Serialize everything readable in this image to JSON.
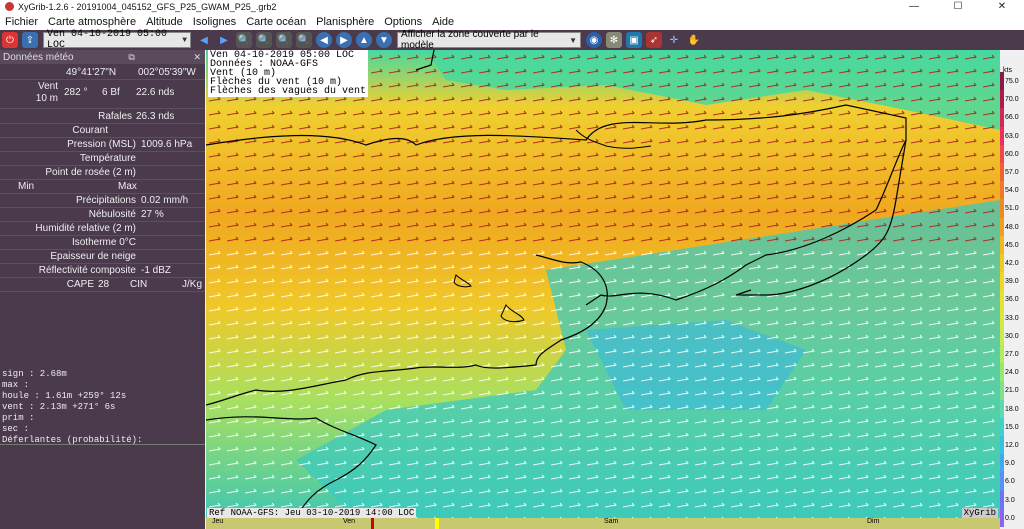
{
  "window": {
    "title": "XyGrib-1.2.6 - 20191004_045152_GFS_P25_GWAM_P25_.grb2"
  },
  "menu": [
    "Fichier",
    "Carte atmosphère",
    "Altitude",
    "Isolignes",
    "Carte océan",
    "Planisphère",
    "Options",
    "Aide"
  ],
  "toolbar": {
    "date": "Ven 04-10-2019 05:00 LOC",
    "zone": "Afficher la zone couverte par le modèle"
  },
  "panel": {
    "title": "Données météo",
    "lat": "49°41'27\"N",
    "lon": "002°05'39\"W",
    "vent_label": "Vent",
    "vent_sub": "10 m",
    "vent_dir": "282 °",
    "vent_bf": "6 Bf",
    "vent_speed": "22.6  nds",
    "rafales_label": "Rafales",
    "rafales": "26.3  nds",
    "courant_label": "Courant",
    "pression_label": "Pression (MSL)",
    "pression": "1009.6 hPa",
    "temperature_label": "Température",
    "rosee_label": "Point de rosée (2 m)",
    "min_label": "Min",
    "max_label": "Max",
    "precip_label": "Précipitations",
    "precip": "0.02 mm/h",
    "nebulosite_label": "Nébulosité",
    "nebulosite": "27 %",
    "humidite_label": "Humidité relative (2 m)",
    "isotherme_label": "Isotherme 0°C",
    "neige_label": "Epaisseur de neige",
    "reflect_label": "Réflectivité composite",
    "reflect": "-1 dBZ",
    "cape_label": "CAPE",
    "cape": "28",
    "cin_label": "CIN",
    "jkg": "J/Kg",
    "waves": [
      "sign :  2.68m",
      "max :",
      "houle :  1.61m +259°  12s",
      "vent :  2.13m +271°   6s",
      "prim :",
      "sec :",
      "Déferlantes (probabilité):"
    ]
  },
  "map": {
    "overlay": [
      "Ven 04-10-2019 05:00 LOC",
      "Données : NOAA-GFS",
      "Vent (10 m)",
      "Flèches du vent (10 m)",
      "Flèches des vagues du vent"
    ],
    "ref": "Ref NOAA-GFS: Jeu 03-10-2019 14:00 LOC",
    "brand": "XyGrib"
  },
  "scale": {
    "unit": "kts",
    "values": [
      "75.0",
      "70.0",
      "66.0",
      "63.0",
      "60.0",
      "57.0",
      "54.0",
      "51.0",
      "48.0",
      "45.0",
      "42.0",
      "39.0",
      "36.0",
      "33.0",
      "30.0",
      "27.0",
      "24.0",
      "21.0",
      "18.0",
      "15.0",
      "12.0",
      "9.0",
      "6.0",
      "3.0",
      "0.0"
    ],
    "colors": [
      "#8b1a4a",
      "#b01c4a",
      "#d0285a",
      "#e83060",
      "#f04848",
      "#f06030",
      "#f07828",
      "#f08a20",
      "#f0a020",
      "#f0b820",
      "#f0c820",
      "#f0d820",
      "#e8e030",
      "#d8e840",
      "#c8ec50",
      "#b0ec60",
      "#98e870",
      "#80e090",
      "#60d8b0",
      "#40d0d0",
      "#38c0e0",
      "#40a8f0",
      "#5890f8",
      "#7070f8",
      "#9060f0"
    ]
  },
  "timeline": {
    "days": [
      "Jeu",
      "Ven",
      "Sam",
      "Dim"
    ]
  }
}
